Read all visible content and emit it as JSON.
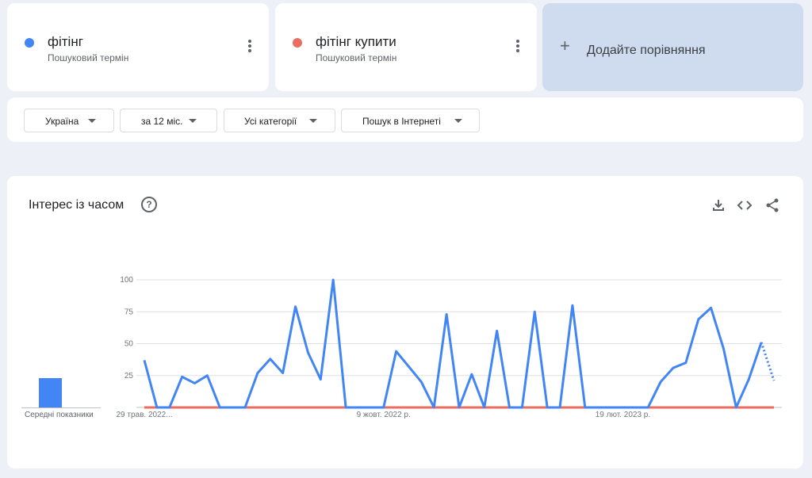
{
  "terms": [
    {
      "name": "фітінг",
      "subtitle": "Пошуковий термін",
      "color": "#4285f4"
    },
    {
      "name": "фітінг купити",
      "subtitle": "Пошуковий термін",
      "color": "#ea6e5f"
    }
  ],
  "add_compare": {
    "label": "Додайте порівняння",
    "icon": "plus-icon"
  },
  "filters": {
    "region": "Україна",
    "period": "за 12 міс.",
    "category": "Усі категорії",
    "search_type": "Пошук в Інтернеті"
  },
  "chart_section": {
    "title": "Інтерес із часом",
    "icons": [
      "help-icon",
      "download-icon",
      "embed-icon",
      "share-icon"
    ],
    "averages_label": "Середні показники",
    "averages": [
      {
        "term": "фітінг",
        "value": 23
      },
      {
        "term": "фітінг купити",
        "value": 0
      }
    ]
  },
  "chart_data": {
    "type": "line",
    "title": "Інтерес із часом",
    "ylim": [
      0,
      100
    ],
    "yticks": [
      25,
      50,
      75,
      100
    ],
    "xtick_labels": [
      {
        "label": "29 трав. 2022...",
        "index": 0
      },
      {
        "label": "9 жовт. 2022 р.",
        "index": 19
      },
      {
        "label": "19 лют. 2023 р.",
        "index": 38
      }
    ],
    "series": [
      {
        "name": "фітінг",
        "color": "#4285f4",
        "partial_from_index": 49,
        "values": [
          37,
          0,
          0,
          24,
          19,
          25,
          0,
          0,
          0,
          27,
          38,
          27,
          79,
          43,
          22,
          100,
          0,
          0,
          0,
          0,
          44,
          32,
          20,
          0,
          73,
          0,
          26,
          0,
          60,
          0,
          0,
          75,
          0,
          0,
          80,
          0,
          0,
          0,
          0,
          0,
          0,
          20,
          31,
          35,
          69,
          78,
          46,
          0,
          22,
          51,
          21
        ]
      },
      {
        "name": "фітінг купити",
        "color": "#ea6e5f",
        "values": [
          0,
          0,
          0,
          0,
          0,
          0,
          0,
          0,
          0,
          0,
          0,
          0,
          0,
          0,
          0,
          0,
          0,
          0,
          0,
          0,
          0,
          0,
          0,
          0,
          0,
          0,
          0,
          0,
          0,
          0,
          0,
          0,
          0,
          0,
          0,
          0,
          0,
          0,
          0,
          0,
          0,
          0,
          0,
          0,
          0,
          0,
          0,
          0,
          0,
          0,
          0
        ]
      }
    ]
  }
}
